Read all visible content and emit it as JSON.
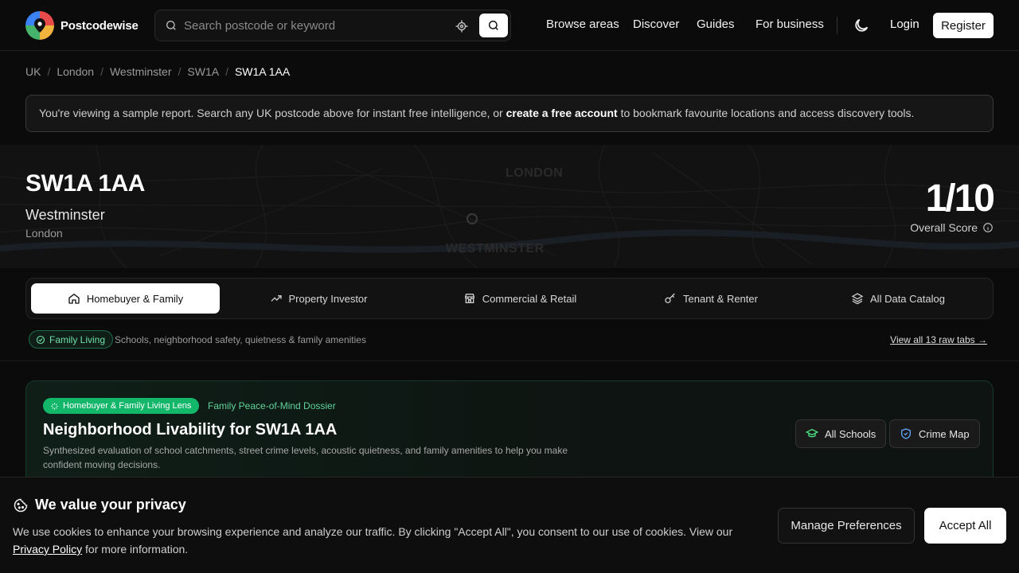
{
  "header": {
    "brand": "Postcodewise",
    "search_placeholder": "Search postcode or keyword",
    "nav": [
      "Browse areas",
      "Discover",
      "Guides",
      "For business"
    ],
    "login": "Login",
    "register": "Register"
  },
  "breadcrumb": [
    "UK",
    "London",
    "Westminster",
    "SW1A",
    "SW1A 1AA"
  ],
  "notice": {
    "before": "You're viewing a sample report. Search any UK postcode above for instant free intelligence, or ",
    "link": "create a free account",
    "after": " to bookmark favourite locations and access discovery tools."
  },
  "hero": {
    "postcode": "SW1A 1AA",
    "district": "Westminster",
    "city": "London",
    "score": "1/10",
    "score_label": "Overall Score",
    "map_labels": [
      "LONDON",
      "WESTMINSTER"
    ]
  },
  "tabs": [
    {
      "label": "Homebuyer & Family",
      "icon": "home-icon",
      "active": true
    },
    {
      "label": "Property Investor",
      "icon": "trending-up-icon",
      "active": false
    },
    {
      "label": "Commercial & Retail",
      "icon": "store-icon",
      "active": false
    },
    {
      "label": "Tenant & Renter",
      "icon": "key-icon",
      "active": false
    },
    {
      "label": "All Data Catalog",
      "icon": "layers-icon",
      "active": false
    }
  ],
  "lens": {
    "pill": "Family Living",
    "description": "Schools, neighborhood safety, quietness & family amenities",
    "view_all": "View all 13 raw tabs →"
  },
  "card": {
    "badge": "Homebuyer & Family Living Lens",
    "dossier": "Family Peace-of-Mind Dossier",
    "title": "Neighborhood Livability for SW1A 1AA",
    "description": "Synthesized evaluation of school catchments, street crime levels, acoustic quietness, and family amenities to help you make confident moving decisions.",
    "buttons": [
      "All Schools",
      "Crime Map"
    ]
  },
  "cookie": {
    "title": "We value your privacy",
    "text_before": "We use cookies to enhance your browsing experience and analyze our traffic. By clicking \"Accept All\", you consent to our use of cookies. View our ",
    "link": "Privacy Policy",
    "text_after": " for more information.",
    "manage": "Manage Preferences",
    "accept": "Accept All"
  },
  "colors": {
    "accent_green": "#12b76a",
    "background": "#0b0b0b"
  }
}
